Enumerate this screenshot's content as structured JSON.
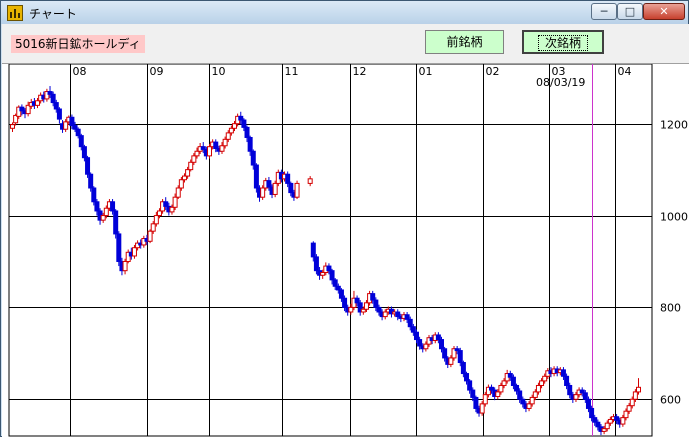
{
  "window": {
    "title": "チャート",
    "controls": {
      "minimize": "─",
      "maximize": "□",
      "close": "✕"
    }
  },
  "toolbar": {
    "stock_label": "5016新日鉱ホールディ",
    "prev_button": "前銘柄",
    "next_button": "次銘柄"
  },
  "icons": {
    "app": "chart-app-icon"
  },
  "colors": {
    "up_candle": "#d40000",
    "down_candle": "#0000d8",
    "cursor_line": "#cc33cc",
    "stock_label_bg": "#ffc8c8",
    "button_bg": "#ccffcc"
  },
  "chart_data": {
    "type": "candlestick",
    "cursor_date": "08/03/19",
    "month_labels": [
      "08",
      "09",
      "10",
      "11",
      "12",
      "01",
      "02",
      "03",
      "04"
    ],
    "y_ticks": [
      1200,
      1000,
      800,
      600
    ],
    "ylim": [
      520,
      1330
    ],
    "grid": true,
    "candles": [
      [
        1190,
        1198,
        1182,
        1203
      ],
      [
        1202,
        1218,
        1196,
        1222
      ],
      [
        1216,
        1236,
        1210,
        1240
      ],
      [
        1236,
        1228,
        1218,
        1242
      ],
      [
        1228,
        1222,
        1212,
        1234
      ],
      [
        1222,
        1240,
        1216,
        1248
      ],
      [
        1238,
        1246,
        1232,
        1254
      ],
      [
        1248,
        1240,
        1232,
        1256
      ],
      [
        1240,
        1250,
        1234,
        1256
      ],
      [
        1250,
        1262,
        1244,
        1268
      ],
      [
        1262,
        1254,
        1246,
        1270
      ],
      [
        1254,
        1270,
        1248,
        1276
      ],
      [
        1270,
        1264,
        1256,
        1282
      ],
      [
        1264,
        1246,
        1238,
        1270
      ],
      [
        1246,
        1232,
        1224,
        1252
      ],
      [
        1232,
        1210,
        1200,
        1236
      ],
      [
        1200,
        1188,
        1180,
        1208
      ],
      [
        1188,
        1204,
        1182,
        1210
      ],
      [
        1204,
        1214,
        1198,
        1218
      ],
      [
        1214,
        1196,
        1188,
        1220
      ],
      [
        1196,
        1188,
        1182,
        1204
      ],
      [
        1188,
        1174,
        1168,
        1192
      ],
      [
        1174,
        1150,
        1142,
        1178
      ],
      [
        1150,
        1126,
        1118,
        1154
      ],
      [
        1126,
        1090,
        1082,
        1130
      ],
      [
        1090,
        1060,
        1052,
        1094
      ],
      [
        1060,
        1030,
        1022,
        1064
      ],
      [
        1030,
        1010,
        1000,
        1036
      ],
      [
        1010,
        990,
        980,
        1016
      ],
      [
        990,
        1000,
        984,
        1006
      ],
      [
        1000,
        1016,
        994,
        1022
      ],
      [
        1016,
        1030,
        1010,
        1036
      ],
      [
        1030,
        1010,
        1002,
        1036
      ],
      [
        1010,
        960,
        950,
        1014
      ],
      [
        960,
        900,
        890,
        966
      ],
      [
        900,
        880,
        870,
        908
      ],
      [
        880,
        900,
        872,
        906
      ],
      [
        900,
        920,
        896,
        926
      ],
      [
        920,
        912,
        904,
        930
      ],
      [
        912,
        930,
        906,
        936
      ],
      [
        930,
        940,
        924,
        946
      ],
      [
        940,
        936,
        928,
        948
      ],
      [
        936,
        950,
        930,
        956
      ],
      [
        950,
        944,
        936,
        958
      ],
      [
        944,
        966,
        940,
        970
      ],
      [
        966,
        982,
        960,
        988
      ],
      [
        982,
        1000,
        976,
        1008
      ],
      [
        1000,
        1010,
        994,
        1016
      ],
      [
        1010,
        1030,
        1004,
        1036
      ],
      [
        1030,
        1020,
        1012,
        1040
      ],
      [
        1020,
        1008,
        1000,
        1028
      ],
      [
        1008,
        1018,
        1002,
        1024
      ],
      [
        1018,
        1040,
        1012,
        1048
      ],
      [
        1040,
        1060,
        1036,
        1066
      ],
      [
        1060,
        1078,
        1054,
        1084
      ],
      [
        1078,
        1086,
        1072,
        1092
      ],
      [
        1086,
        1100,
        1080,
        1106
      ],
      [
        1100,
        1116,
        1096,
        1122
      ],
      [
        1116,
        1130,
        1110,
        1136
      ],
      [
        1130,
        1140,
        1124,
        1148
      ],
      [
        1140,
        1150,
        1134,
        1158
      ],
      [
        1150,
        1144,
        1136,
        1160
      ],
      [
        1144,
        1130,
        1122,
        1150
      ],
      [
        1130,
        1150,
        1124,
        1156
      ],
      [
        1150,
        1160,
        1144,
        1166
      ],
      [
        1160,
        1146,
        1138,
        1166
      ],
      [
        1146,
        1140,
        1132,
        1152
      ],
      [
        1140,
        1152,
        1134,
        1160
      ],
      [
        1152,
        1166,
        1146,
        1172
      ],
      [
        1166,
        1180,
        1160,
        1186
      ],
      [
        1180,
        1190,
        1174,
        1196
      ],
      [
        1190,
        1200,
        1184,
        1206
      ],
      [
        1200,
        1216,
        1194,
        1222
      ],
      [
        1216,
        1208,
        1198,
        1226
      ],
      [
        1208,
        1192,
        1184,
        1212
      ],
      [
        1192,
        1170,
        1160,
        1196
      ],
      [
        1170,
        1140,
        1130,
        1174
      ],
      [
        1140,
        1110,
        1100,
        1144
      ],
      [
        1110,
        1060,
        1050,
        1114
      ],
      [
        1060,
        1040,
        1030,
        1066
      ],
      [
        1040,
        1060,
        1034,
        1066
      ],
      [
        1060,
        1076,
        1054,
        1082
      ],
      [
        1076,
        1062,
        1054,
        1084
      ],
      [
        1062,
        1046,
        1038,
        1068
      ],
      [
        1046,
        1070,
        1040,
        1076
      ],
      [
        1070,
        1094,
        1064,
        1100
      ],
      [
        1094,
        1080,
        1072,
        1100
      ],
      [
        1080,
        1090,
        1074,
        1096
      ],
      [
        1090,
        1070,
        1062,
        1096
      ],
      [
        1070,
        1050,
        1042,
        1074
      ],
      [
        1050,
        1040,
        1032,
        1056
      ],
      [
        1040,
        1070,
        1036,
        1076
      ],
      [
        1070,
        1080,
        1064,
        1086
      ],
      [
        940,
        910,
        900,
        944
      ],
      [
        910,
        880,
        872,
        916
      ],
      [
        880,
        870,
        860,
        888
      ],
      [
        870,
        876,
        862,
        882
      ],
      [
        876,
        890,
        870,
        898
      ],
      [
        890,
        880,
        872,
        896
      ],
      [
        880,
        860,
        850,
        884
      ],
      [
        860,
        846,
        838,
        864
      ],
      [
        846,
        838,
        830,
        852
      ],
      [
        838,
        820,
        812,
        842
      ],
      [
        820,
        800,
        792,
        826
      ],
      [
        800,
        790,
        782,
        806
      ],
      [
        790,
        800,
        784,
        808
      ],
      [
        800,
        820,
        794,
        836
      ],
      [
        820,
        810,
        802,
        826
      ],
      [
        810,
        790,
        782,
        816
      ],
      [
        790,
        796,
        784,
        802
      ],
      [
        796,
        810,
        790,
        816
      ],
      [
        810,
        830,
        804,
        836
      ],
      [
        830,
        816,
        808,
        836
      ],
      [
        816,
        800,
        792,
        822
      ],
      [
        800,
        790,
        782,
        806
      ],
      [
        790,
        780,
        772,
        796
      ],
      [
        780,
        790,
        774,
        796
      ],
      [
        790,
        796,
        784,
        802
      ],
      [
        796,
        786,
        778,
        802
      ],
      [
        786,
        790,
        780,
        796
      ],
      [
        790,
        780,
        772,
        796
      ],
      [
        780,
        776,
        768,
        786
      ],
      [
        776,
        784,
        770,
        790
      ],
      [
        784,
        774,
        766,
        790
      ],
      [
        774,
        758,
        750,
        780
      ],
      [
        758,
        746,
        738,
        764
      ],
      [
        746,
        730,
        722,
        752
      ],
      [
        730,
        716,
        708,
        736
      ],
      [
        716,
        710,
        702,
        722
      ],
      [
        710,
        720,
        704,
        726
      ],
      [
        720,
        734,
        714,
        740
      ],
      [
        734,
        728,
        720,
        740
      ],
      [
        728,
        740,
        722,
        746
      ],
      [
        740,
        730,
        722,
        746
      ],
      [
        730,
        710,
        702,
        736
      ],
      [
        710,
        690,
        682,
        714
      ],
      [
        690,
        676,
        668,
        694
      ],
      [
        676,
        690,
        670,
        696
      ],
      [
        690,
        710,
        684,
        716
      ],
      [
        710,
        706,
        698,
        716
      ],
      [
        706,
        680,
        672,
        712
      ],
      [
        680,
        656,
        648,
        684
      ],
      [
        656,
        640,
        632,
        660
      ],
      [
        640,
        620,
        612,
        644
      ],
      [
        620,
        604,
        596,
        626
      ],
      [
        604,
        580,
        572,
        608
      ],
      [
        580,
        570,
        562,
        586
      ],
      [
        570,
        590,
        564,
        596
      ],
      [
        590,
        610,
        584,
        616
      ],
      [
        610,
        626,
        604,
        632
      ],
      [
        626,
        620,
        612,
        632
      ],
      [
        620,
        606,
        598,
        626
      ],
      [
        606,
        616,
        600,
        622
      ],
      [
        616,
        630,
        610,
        636
      ],
      [
        630,
        640,
        624,
        646
      ],
      [
        640,
        656,
        634,
        664
      ],
      [
        656,
        648,
        640,
        662
      ],
      [
        648,
        630,
        622,
        654
      ],
      [
        630,
        618,
        610,
        634
      ],
      [
        618,
        600,
        592,
        624
      ],
      [
        600,
        590,
        582,
        606
      ],
      [
        590,
        580,
        572,
        596
      ],
      [
        580,
        590,
        574,
        596
      ],
      [
        590,
        604,
        584,
        610
      ],
      [
        604,
        616,
        598,
        622
      ],
      [
        616,
        630,
        610,
        636
      ],
      [
        630,
        640,
        624,
        646
      ],
      [
        640,
        650,
        634,
        656
      ],
      [
        650,
        662,
        644,
        668
      ],
      [
        662,
        656,
        648,
        670
      ],
      [
        656,
        666,
        650,
        672
      ],
      [
        666,
        658,
        650,
        672
      ],
      [
        658,
        664,
        652,
        670
      ],
      [
        664,
        650,
        642,
        670
      ],
      [
        650,
        630,
        622,
        656
      ],
      [
        630,
        610,
        602,
        636
      ],
      [
        610,
        600,
        592,
        616
      ],
      [
        600,
        610,
        594,
        616
      ],
      [
        610,
        620,
        604,
        626
      ],
      [
        620,
        614,
        606,
        626
      ],
      [
        614,
        600,
        592,
        620
      ],
      [
        600,
        580,
        572,
        606
      ],
      [
        580,
        560,
        552,
        586
      ],
      [
        560,
        550,
        542,
        566
      ],
      [
        550,
        540,
        532,
        556
      ],
      [
        540,
        530,
        522,
        546
      ],
      [
        530,
        536,
        524,
        542
      ],
      [
        536,
        548,
        530,
        554
      ],
      [
        548,
        556,
        542,
        562
      ],
      [
        556,
        562,
        550,
        568
      ],
      [
        562,
        554,
        546,
        568
      ],
      [
        554,
        546,
        538,
        560
      ],
      [
        546,
        560,
        540,
        566
      ],
      [
        560,
        574,
        554,
        580
      ],
      [
        574,
        586,
        568,
        592
      ],
      [
        586,
        600,
        580,
        606
      ],
      [
        600,
        616,
        594,
        622
      ],
      [
        616,
        626,
        610,
        646
      ]
    ]
  }
}
